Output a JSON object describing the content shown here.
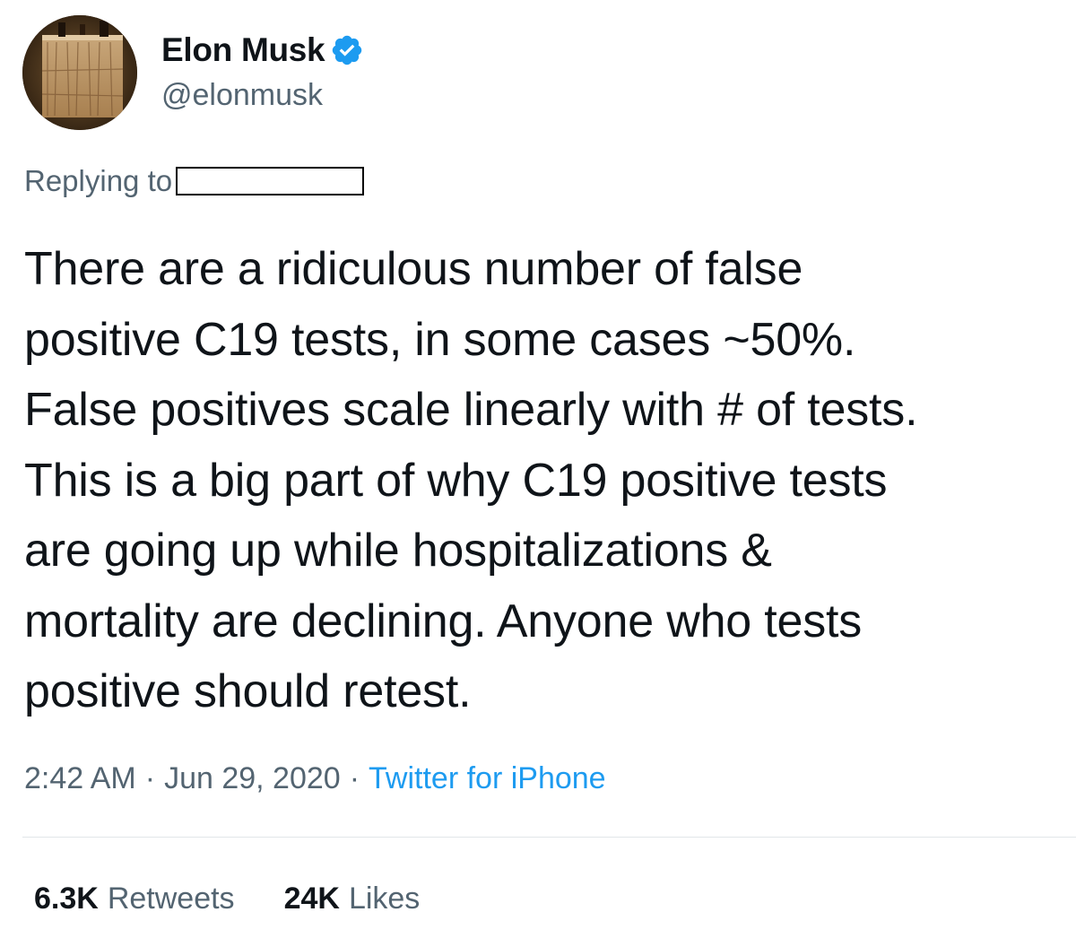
{
  "author": {
    "display_name": "Elon Musk",
    "handle": "@elonmusk",
    "avatar_icon": "profile-photo",
    "verified_icon": "verified-badge-icon"
  },
  "reply": {
    "label": "Replying to"
  },
  "tweet": {
    "text": "There are a ridiculous number of false\npositive C19 tests, in some cases ~50%.\nFalse positives scale linearly with # of tests.\nThis is a big part of why C19 positive tests\nare going up while hospitalizations &\nmortality are declining. Anyone who tests\npositive should retest."
  },
  "meta": {
    "time": "2:42 AM",
    "separator": "·",
    "date": "Jun 29, 2020",
    "source": "Twitter for iPhone"
  },
  "stats": {
    "retweets_count": "6.3K",
    "retweets_label": "Retweets",
    "likes_count": "24K",
    "likes_label": "Likes"
  },
  "colors": {
    "primary_text": "#0f1419",
    "secondary_text": "#536471",
    "accent": "#1d9bf0",
    "divider": "#e2e6e9"
  }
}
